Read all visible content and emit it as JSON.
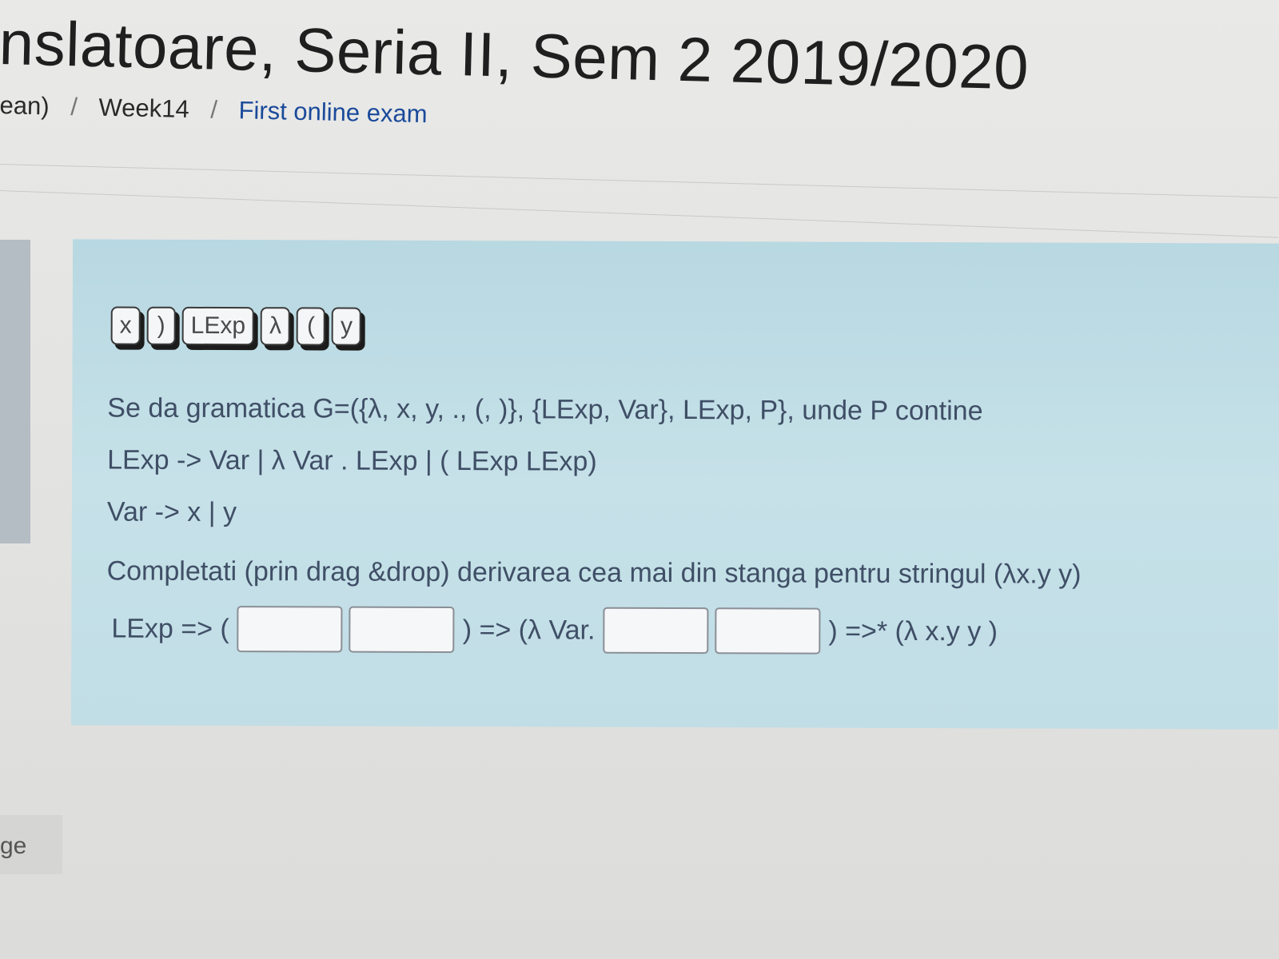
{
  "header": {
    "title": "nslatoare, Seria II, Sem 2 2019/2020",
    "breadcrumb": {
      "item1": "ean)",
      "item2": "Week14",
      "current": "First online exam",
      "separator": "/"
    }
  },
  "question": {
    "tokens": [
      "x",
      ")",
      "LExp",
      "λ",
      "(",
      "y"
    ],
    "text_line1": "Se da gramatica G=({λ, x, y, ., (, )}, {LExp, Var}, LExp, P}, unde P contine",
    "text_line2": "LExp -> Var | λ Var . LExp | ( LExp LExp)",
    "text_line3": "Var -> x | y",
    "text_line4": "Completati (prin drag &drop) derivarea cea mai din stanga pentru stringul (λx.y   y)",
    "derivation": {
      "part1": "LExp => (",
      "part2": ") => (λ Var.",
      "part3": ") =>* (λ x.y y )"
    }
  },
  "sidebar": {
    "bottom_label": "ge"
  },
  "colors": {
    "panel_bg": "#c2dde6",
    "link": "#1a4a9a",
    "question_text": "#3f4f66"
  }
}
